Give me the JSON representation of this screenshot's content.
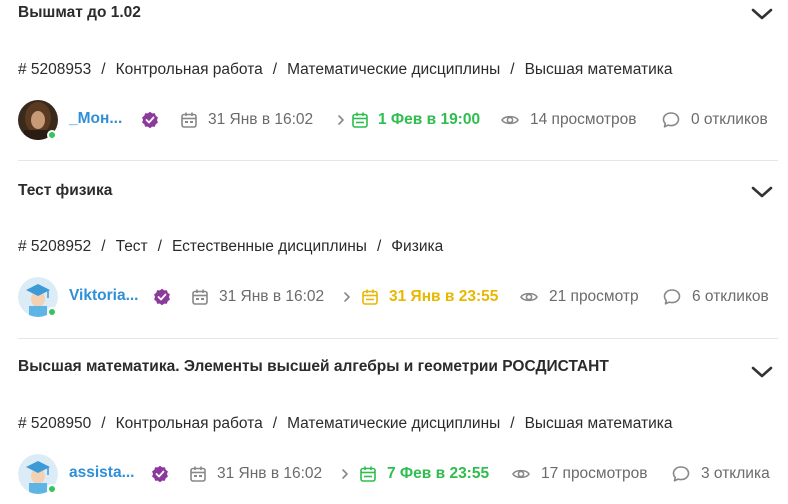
{
  "orders": [
    {
      "title": "Вышмат до 1.02",
      "crumbs": [
        "# 5208953",
        "Контрольная работа",
        "Математические дисциплины",
        "Высшая математика"
      ],
      "user": "_Мон...",
      "created": "31 Янв в 16:02",
      "deadline": "1 Фев в 19:00",
      "deadline_color": "#2ebd4e",
      "views": "14 просмотров",
      "responses": "0 откликов"
    },
    {
      "title": "Тест физика",
      "crumbs": [
        "# 5208952",
        "Тест",
        "Естественные дисциплины",
        "Физика"
      ],
      "user": "Viktoria...",
      "created": "31 Янв в 16:02",
      "deadline": "31 Янв в 23:55",
      "deadline_color": "#e8b800",
      "views": "21 просмотр",
      "responses": "6 откликов"
    },
    {
      "title": "Высшая математика. Элементы высшей алгебры и геометрии РОСДИСТАНТ",
      "crumbs": [
        "# 5208950",
        "Контрольная работа",
        "Математические дисциплины",
        "Высшая математика"
      ],
      "user": "assista...",
      "created": "31 Янв в 16:02",
      "deadline": "7 Фев в 23:55",
      "deadline_color": "#2ebd4e",
      "views": "17 просмотров",
      "responses": "3 отклика"
    }
  ],
  "crumb_separator": "/",
  "icons": {
    "expand": "chevron-down-icon",
    "verified": "verified-badge-icon",
    "created": "calendar-icon",
    "deadline": "calendar-check-icon",
    "arrow": "chevron-right-icon",
    "views": "eye-icon",
    "responses": "comment-icon"
  },
  "colors": {
    "link": "#2f8fd8",
    "verified": "#8b3a9c",
    "online": "#36c35a",
    "muted": "#6b6b6b"
  }
}
